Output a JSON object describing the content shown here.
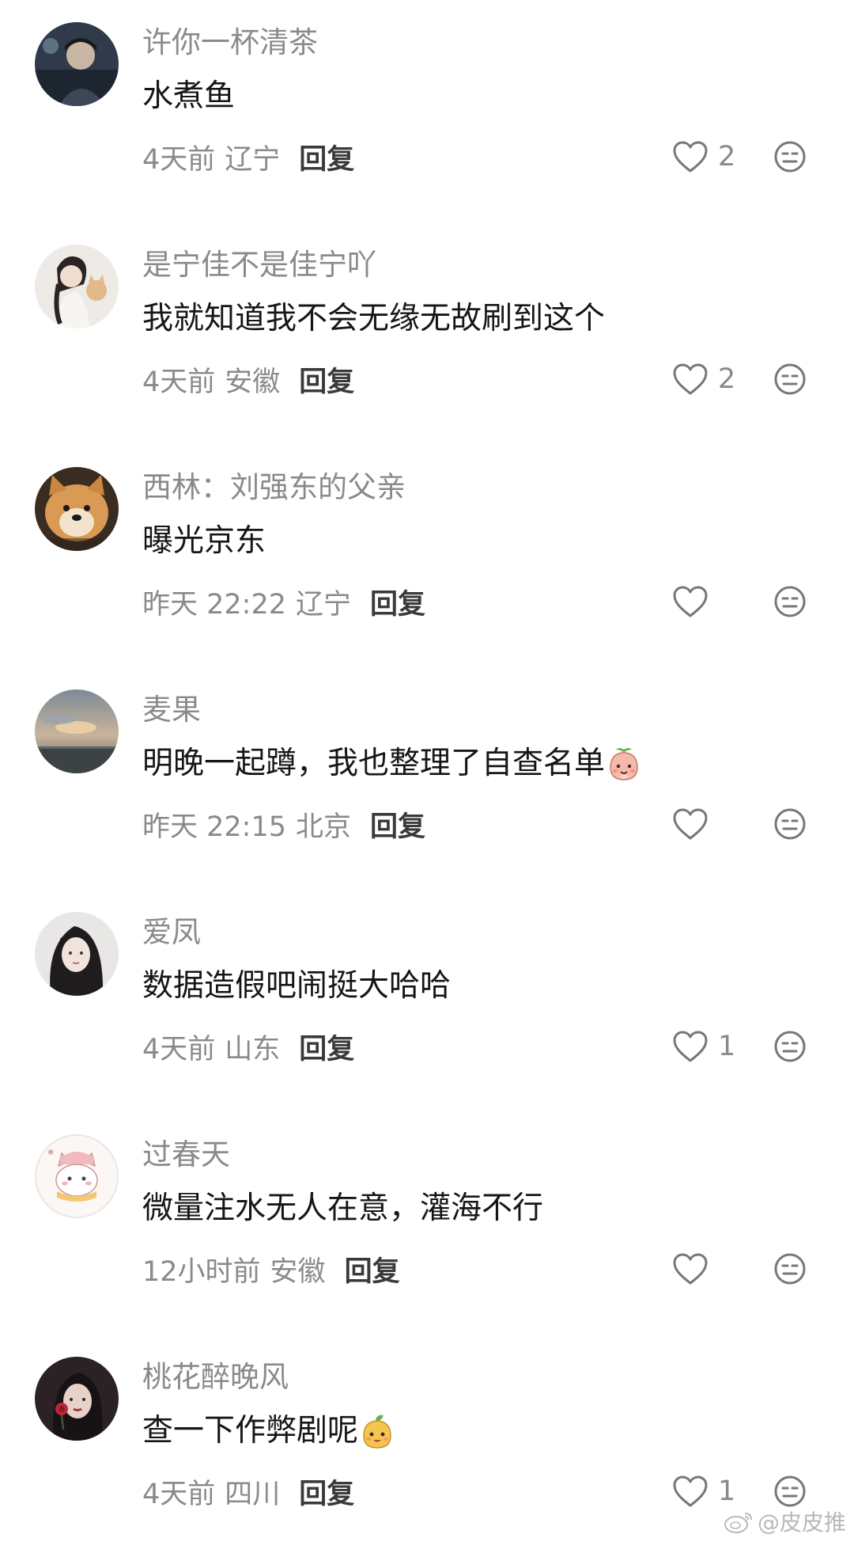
{
  "comments": [
    {
      "username": "许你一杯清茶",
      "content": "水煮鱼",
      "time": "4天前",
      "location": "辽宁",
      "reply": "回复",
      "likes": "2",
      "avatar_icon": "avatar-man-dark",
      "emoji": ""
    },
    {
      "username": "是宁佳不是佳宁吖",
      "content": "我就知道我不会无缘无故刷到这个",
      "time": "4天前",
      "location": "安徽",
      "reply": "回复",
      "likes": "2",
      "avatar_icon": "avatar-woman-with-cat",
      "emoji": ""
    },
    {
      "username": "西林：刘强东的父亲",
      "content": "曝光京东",
      "time": "昨天 22:22",
      "location": "辽宁",
      "reply": "回复",
      "likes": "",
      "avatar_icon": "avatar-shiba-dog",
      "emoji": ""
    },
    {
      "username": "麦果",
      "content": "明晚一起蹲，我也整理了自查名单",
      "time": "昨天 22:15",
      "location": "北京",
      "reply": "回复",
      "likes": "",
      "avatar_icon": "avatar-sunset-sky",
      "emoji": "peach-face-emoji"
    },
    {
      "username": "爱凤",
      "content": "数据造假吧闹挺大哈哈",
      "time": "4天前",
      "location": "山东",
      "reply": "回复",
      "likes": "1",
      "avatar_icon": "avatar-woman-long-hair",
      "emoji": ""
    },
    {
      "username": "过春天",
      "content": "微量注水无人在意，灌海不行",
      "time": "12小时前",
      "location": "安徽",
      "reply": "回复",
      "likes": "",
      "avatar_icon": "avatar-cartoon-cat",
      "emoji": ""
    },
    {
      "username": "桃花醉晚风",
      "content": "查一下作弊剧呢",
      "time": "4天前",
      "location": "四川",
      "reply": "回复",
      "likes": "1",
      "avatar_icon": "avatar-woman-rose",
      "emoji": "mango-face-emoji"
    }
  ],
  "watermark": "@皮皮推",
  "colors": {
    "username": "#8a8a8a",
    "content": "#161616",
    "meta": "#8a8a8a",
    "reply": "#3a3a3a",
    "icon": "#777777"
  }
}
